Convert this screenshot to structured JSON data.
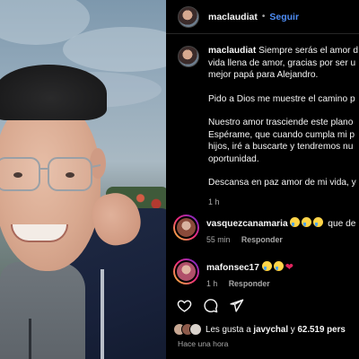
{
  "post": {
    "username": "maclaudiat",
    "follow_label": "Seguir",
    "follow_separator": "•"
  },
  "caption": {
    "username": "maclaudiat",
    "line1": "Siempre serás el amor d",
    "line2": "vida llena de amor, gracias por ser u",
    "line3": "mejor papá para Alejandro.",
    "line4": "Pido a Dios me muestre el camino p",
    "line5": "Nuestro amor trasciende este plano",
    "line6": "Espérame, que cuando cumpla mi p",
    "line7": "hijos, iré a buscarte y tendremos nu",
    "line8": "oportunidad.",
    "line9": "Descansa en paz amor de mi vida, y",
    "time": "1 h"
  },
  "comments": [
    {
      "username": "vasquezcanamaria",
      "emojis": [
        "crying-face",
        "crying-face",
        "crying-face"
      ],
      "text": "que de",
      "time": "55 min",
      "reply_label": "Responder",
      "avatar_color": "#8a4a3a"
    },
    {
      "username": "mafonsec17",
      "emojis": [
        "crying-face",
        "crying-face",
        "broken-heart"
      ],
      "text": "",
      "time": "1 h",
      "reply_label": "Responder",
      "avatar_color": "#b0506a"
    }
  ],
  "actions": {
    "like_icon": "heart-outline-icon",
    "comment_icon": "comment-bubble-icon",
    "share_icon": "paper-plane-icon"
  },
  "likes": {
    "prefix": "Les gusta a",
    "user": "javychal",
    "connector": "y",
    "count": "62.519",
    "suffix": "pers"
  },
  "posted_ago": "Hace una hora",
  "colors": {
    "background": "#000000",
    "text": "#f5f5f5",
    "muted": "#a8a8a8",
    "follow": "#4e8df5"
  }
}
